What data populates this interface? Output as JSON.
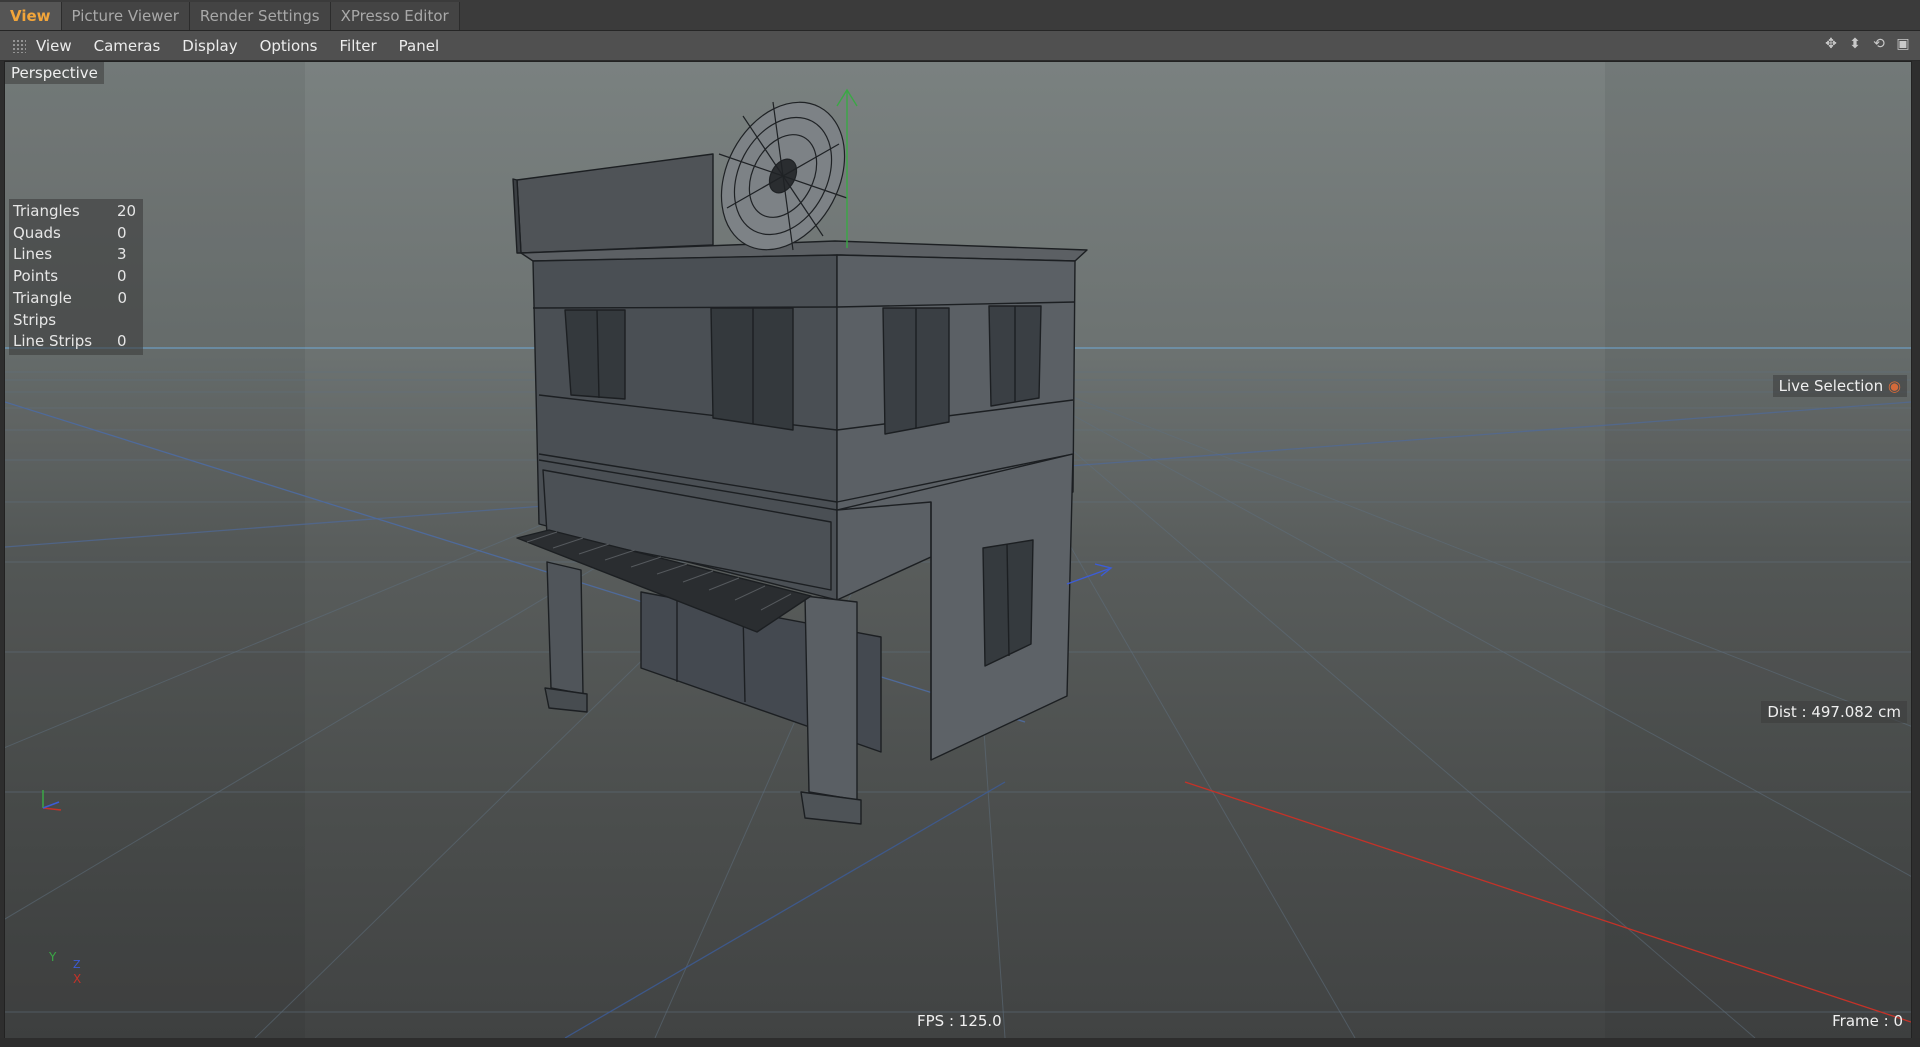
{
  "tabs": [
    {
      "label": "View",
      "active": true
    },
    {
      "label": "Picture Viewer",
      "active": false
    },
    {
      "label": "Render Settings",
      "active": false
    },
    {
      "label": "XPresso Editor",
      "active": false
    }
  ],
  "menu": [
    "View",
    "Cameras",
    "Display",
    "Options",
    "Filter",
    "Panel"
  ],
  "nav_icons": [
    "move-view-icon",
    "dolly-icon",
    "rotate-view-icon",
    "maximize-view-icon"
  ],
  "viewport": {
    "camera_label": "Perspective",
    "live_selection": "Live Selection",
    "distance": "Dist : 497.082 cm",
    "fps": "FPS : 125.0",
    "frame": "Frame : 0",
    "axis_labels": {
      "y": "Y",
      "x": "X",
      "z": "Z"
    }
  },
  "stats": [
    {
      "label": "Triangles",
      "value": "20"
    },
    {
      "label": "Quads",
      "value": "0"
    },
    {
      "label": "Lines",
      "value": "3"
    },
    {
      "label": "Points",
      "value": "0"
    },
    {
      "label": "Triangle Strips",
      "value": "0"
    },
    {
      "label": "Line Strips",
      "value": "0"
    }
  ],
  "colors": {
    "active_tab": "#f2a53a",
    "axis_x": "#d23a2a",
    "axis_y": "#3aa845",
    "axis_z": "#3c5cd6",
    "horizon": "#6fa9d6"
  }
}
